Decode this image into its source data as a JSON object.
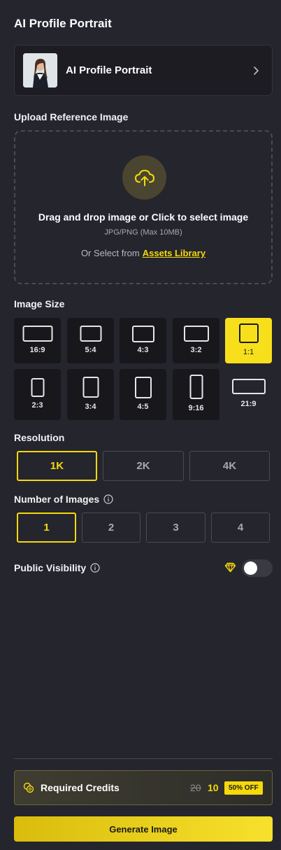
{
  "page_title": "AI Profile Portrait",
  "model": {
    "name": "AI Profile Portrait",
    "thumbnail_icon": "portrait-photo",
    "arrow_icon": "chevron-right-icon"
  },
  "upload": {
    "label": "Upload Reference Image",
    "icon": "cloud-upload-icon",
    "main_text": "Drag and drop image or Click to select image",
    "sub_text": "JPG/PNG (Max 10MB)",
    "alt_prefix": "Or Select from",
    "alt_link": "Assets Library"
  },
  "image_size": {
    "label": "Image Size",
    "selected": "1:1",
    "options": [
      "16:9",
      "5:4",
      "4:3",
      "3:2",
      "1:1",
      "2:3",
      "3:4",
      "4:5",
      "9:16",
      "21:9"
    ]
  },
  "resolution": {
    "label": "Resolution",
    "selected": "1K",
    "options": [
      "1K",
      "2K",
      "4K"
    ]
  },
  "num_images": {
    "label": "Number of Images",
    "selected": "1",
    "options": [
      "1",
      "2",
      "3",
      "4"
    ]
  },
  "visibility": {
    "label": "Public Visibility",
    "enabled": false,
    "premium_icon": "diamond-icon"
  },
  "credits": {
    "label": "Required Credits",
    "original": "20",
    "current": "10",
    "badge": "50% OFF"
  },
  "generate_label": "Generate Image",
  "colors": {
    "accent": "#f5d90a",
    "background": "#25252e",
    "tile": "#17171c"
  }
}
